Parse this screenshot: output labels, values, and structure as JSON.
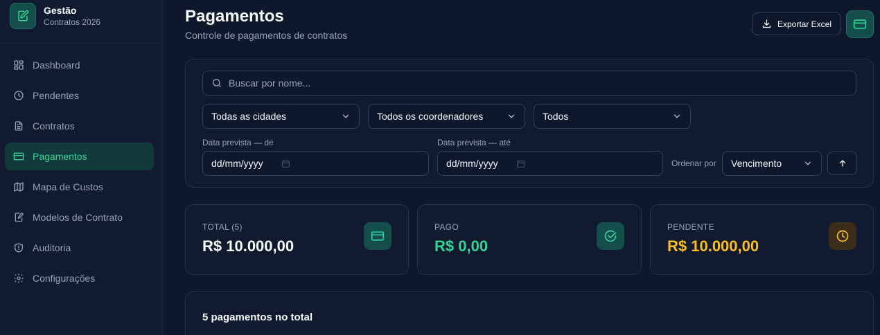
{
  "brand": {
    "title": "Gestão",
    "subtitle": "Contratos 2026"
  },
  "sidebar": {
    "items": [
      {
        "label": "Dashboard",
        "icon": "dashboard-icon"
      },
      {
        "label": "Pendentes",
        "icon": "clock-icon"
      },
      {
        "label": "Contratos",
        "icon": "file-text-icon"
      },
      {
        "label": "Pagamentos",
        "icon": "credit-card-icon",
        "active": true
      },
      {
        "label": "Mapa de Custos",
        "icon": "map-icon"
      },
      {
        "label": "Modelos de Contrato",
        "icon": "file-edit-icon"
      },
      {
        "label": "Auditoria",
        "icon": "shield-icon"
      },
      {
        "label": "Configurações",
        "icon": "gear-icon"
      }
    ]
  },
  "header": {
    "title": "Pagamentos",
    "subtitle": "Controle de pagamentos de contratos",
    "export_label": "Exportar Excel"
  },
  "filters": {
    "search_placeholder": "Buscar por nome...",
    "city": "Todas as cidades",
    "coordinator": "Todos os coordenadores",
    "status": "Todos",
    "date_from_label": "Data prevista — de",
    "date_from_value": "dd/mm/yyyy",
    "date_to_label": "Data prevista — até",
    "date_to_value": "dd/mm/yyyy",
    "order_label": "Ordenar por",
    "order_value": "Vencimento"
  },
  "stats": {
    "total": {
      "label": "TOTAL (5)",
      "value": "R$ 10.000,00"
    },
    "paid": {
      "label": "PAGO",
      "value": "R$ 0,00"
    },
    "pending": {
      "label": "PENDENTE",
      "value": "R$ 10.000,00"
    }
  },
  "list": {
    "title": "5 pagamentos no total"
  },
  "colors": {
    "accent": "#34d399",
    "pending": "#fbbf24",
    "background": "#0f172a",
    "card": "#111a2e"
  }
}
